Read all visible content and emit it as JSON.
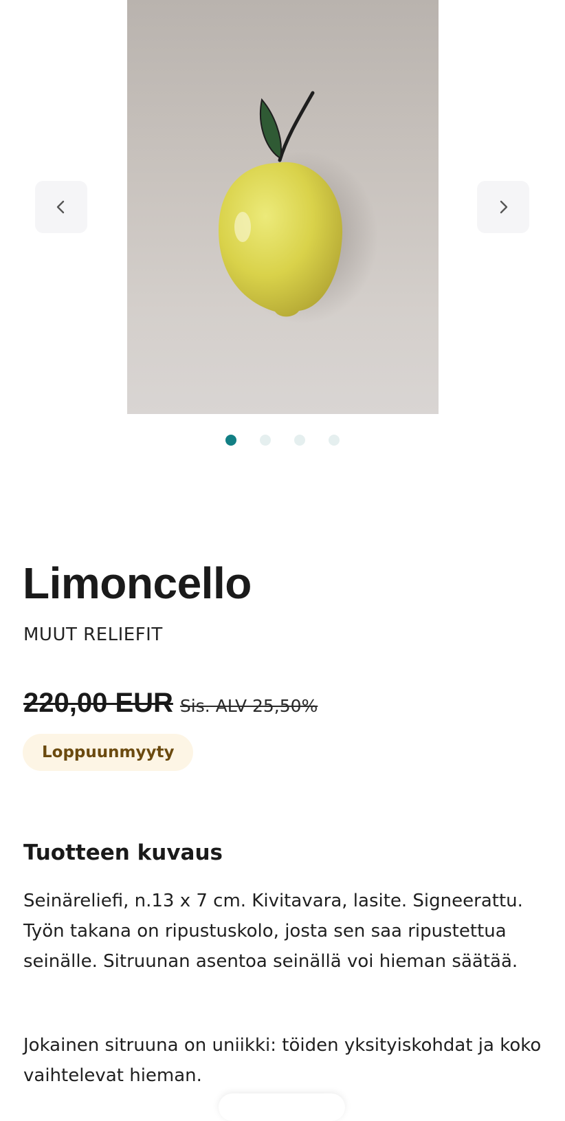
{
  "gallery": {
    "image_alt": "Limoncello",
    "icons": {
      "prev": "chevron-left-icon",
      "next": "chevron-right-icon"
    },
    "slide_count": 4,
    "active_slide": 1,
    "colors": {
      "dot_active": "#127f84",
      "dot_inactive": "#e5efef"
    }
  },
  "product": {
    "title": "Limoncello",
    "category": "MUUT RELIEFIT",
    "price": "220,00 EUR",
    "vat_note": "Sis. ALV 25,50%",
    "status_badge": "Loppuunmyyty"
  },
  "description": {
    "heading": "Tuotteen kuvaus",
    "paragraphs": [
      "Seinäreliefi, n.13 x 7 cm. Kivitavara, lasite. Signeerattu. Työn takana on ripustuskolo, josta sen saa ripustettua seinälle. Sitruunan asentoa seinällä voi hieman säätää.",
      "Jokainen sitruuna on uniikki: töiden yksityiskohdat ja koko vaihtelevat hieman."
    ]
  },
  "colors": {
    "badge_bg": "#fdf5e5",
    "badge_text": "#6b4a0f"
  }
}
